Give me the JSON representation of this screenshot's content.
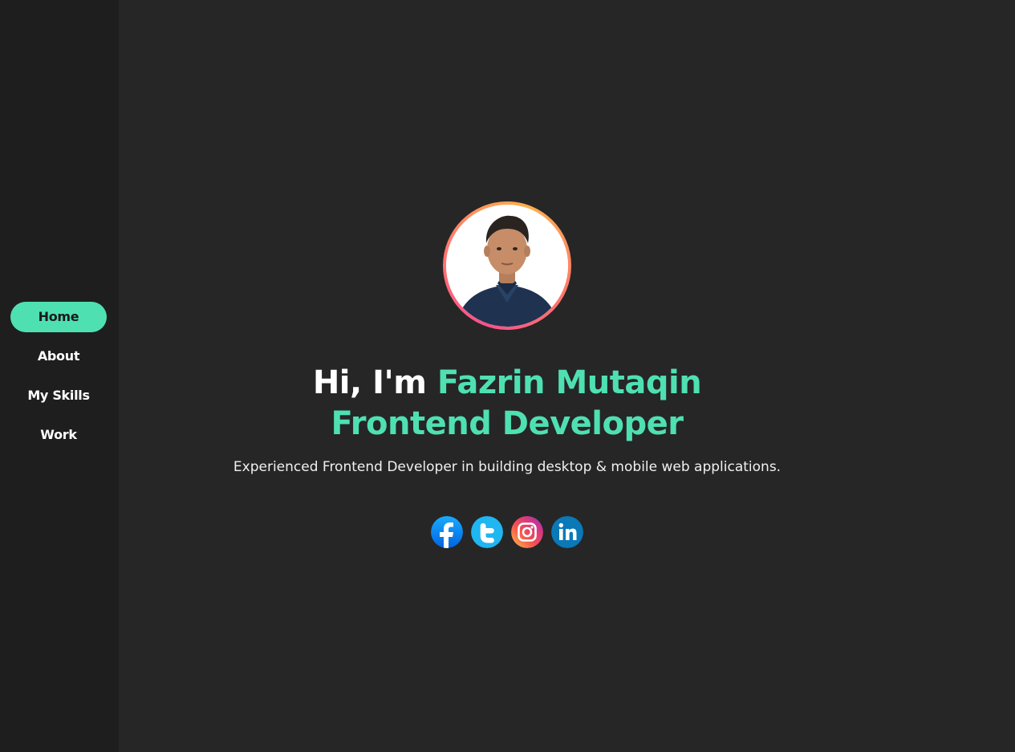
{
  "sidebar": {
    "items": [
      {
        "label": "Home",
        "active": true
      },
      {
        "label": "About",
        "active": false
      },
      {
        "label": "My Skills",
        "active": false
      },
      {
        "label": "Work",
        "active": false
      }
    ]
  },
  "hero": {
    "greeting": "Hi, I'm ",
    "name": "Fazrin Mutaqin",
    "role": "Frontend Developer",
    "description": "Experienced Frontend Developer in building desktop & mobile web applications."
  },
  "social": [
    {
      "icon": "facebook-icon"
    },
    {
      "icon": "twitter-icon"
    },
    {
      "icon": "instagram-icon"
    },
    {
      "icon": "linkedin-icon"
    }
  ],
  "colors": {
    "accent": "#4fe0b2",
    "background": "#262626",
    "sidebar": "#1e1e1e"
  }
}
